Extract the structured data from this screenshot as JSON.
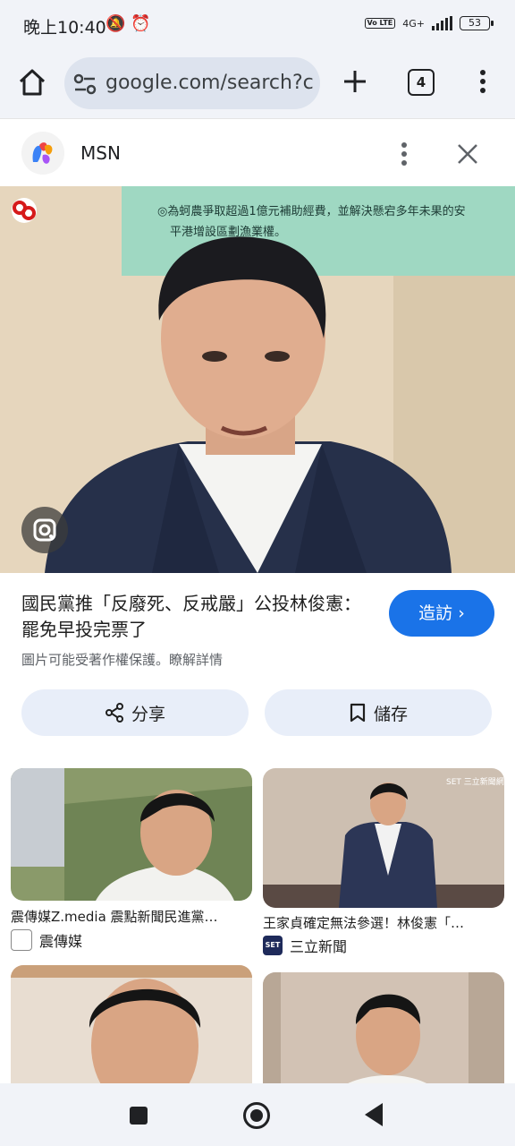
{
  "status_bar": {
    "time": "晚上10:40",
    "icons_left": "🔕 ⏰",
    "volte": "Vo LTE",
    "network": "4G+",
    "battery": "53"
  },
  "browser": {
    "url": "google.com/search?c",
    "tab_count": "4"
  },
  "panel": {
    "source_name": "MSN",
    "title": "國民黨推「反廢死、反戒嚴」公投林俊憲：罷免早投完票了",
    "visit_label": "造訪 ›",
    "copyright_notice": "圖片可能受著作權保護。",
    "learn_more": "瞭解詳情",
    "share_label": "分享",
    "save_label": "儲存"
  },
  "related": [
    {
      "caption": "震傳媒Z.media 震點新聞民進黨…",
      "source": "震傳媒"
    },
    {
      "caption": "王家貞確定無法參選！林俊憲「…",
      "source": "三立新聞"
    },
    {
      "caption": "",
      "source": ""
    },
    {
      "caption": "",
      "source": ""
    }
  ],
  "image_text": {
    "whiteboard_line1": "◎為蚵農爭取超過1億元補助經費，並解決懸宕多年未果的安",
    "whiteboard_line2": "平港增設區劃漁業權。",
    "set_watermark": "SET 三立新聞網"
  }
}
